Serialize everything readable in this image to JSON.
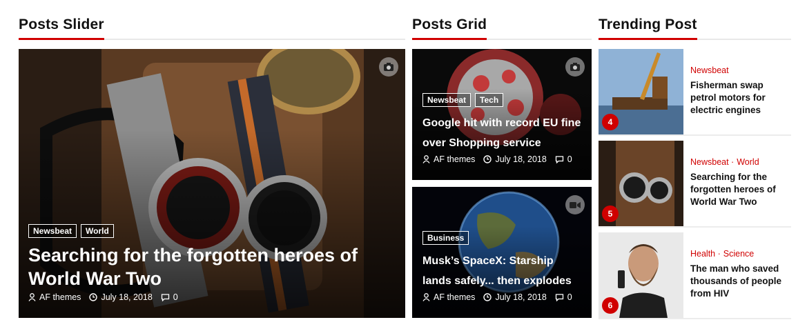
{
  "sections": {
    "slider_title": "Posts Slider",
    "grid_title": "Posts Grid",
    "trending_title": "Trending Post"
  },
  "slider": {
    "tags": [
      "Newsbeat",
      "World"
    ],
    "title": "Searching for the forgotten heroes of World War Two",
    "author": "AF themes",
    "date": "July 18, 2018",
    "comments": "0",
    "media_icon": "camera-icon"
  },
  "grid": [
    {
      "tags": [
        "Newsbeat",
        "Tech"
      ],
      "title": "Google hit with record EU fine over Shopping service",
      "author": "AF themes",
      "date": "July 18, 2018",
      "comments": "0",
      "media_icon": "camera-icon"
    },
    {
      "tags": [
        "Business"
      ],
      "title": "Musk’s SpaceX: Starship lands safely... then explodes",
      "author": "AF themes",
      "date": "July 18, 2018",
      "comments": "0",
      "media_icon": "video-icon"
    }
  ],
  "trending": [
    {
      "rank": "4",
      "cats": [
        "Newsbeat"
      ],
      "title": "Fisherman swap petrol motors for electric engines"
    },
    {
      "rank": "5",
      "cats": [
        "Newsbeat ·",
        "World"
      ],
      "title": "Searching for the forgotten heroes of World War Two"
    },
    {
      "rank": "6",
      "cats": [
        "Health ·",
        "Science"
      ],
      "title": "The man who saved thousands of people from HIV"
    }
  ],
  "colors": {
    "accent": "#d00000"
  }
}
